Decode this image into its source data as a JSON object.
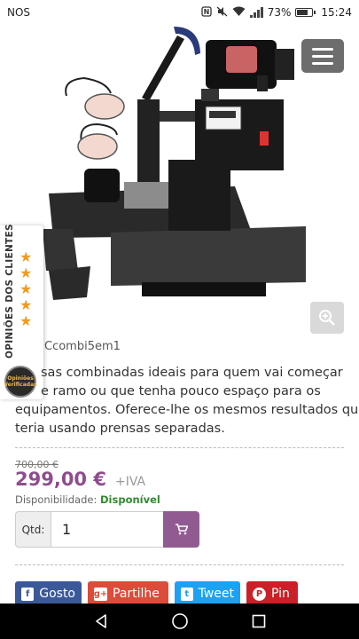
{
  "status_bar": {
    "carrier": "NOS",
    "battery_percent": "73%",
    "battery_level": 0.73,
    "time": "15:24",
    "icons": [
      "nfc-icon",
      "mute-icon",
      "wifi-icon",
      "signal-icon",
      "battery-icon"
    ]
  },
  "header": {
    "menu_icon": "hamburger-icon"
  },
  "product_image": {
    "zoom_icon": "zoom-in-icon"
  },
  "reviews": {
    "label": "OPINIÕES DOS CLIENTES",
    "star_count": 5,
    "badge_text": "Opiniões Verificadas"
  },
  "product": {
    "sku": "Ccombi5em1",
    "description_lines": [
      "sas combinadas ideais para quem vai começar",
      "e ramo ou que tenha pouco espaço para os",
      "equipamentos. Oferece-lhe os mesmos resultados que",
      "teria usando prensas separadas."
    ],
    "old_price": "700,00 €",
    "price": "299,00 €",
    "vat_label": "+IVA",
    "availability_label": "Disponibilidade:",
    "availability_value": "Disponível",
    "qty_label": "Qtd:",
    "qty_value": "1",
    "cart_icon": "cart-icon"
  },
  "social": [
    {
      "label": "Gosto",
      "icon": "facebook-icon",
      "color": "#3b5998"
    },
    {
      "label": "Partilhe",
      "icon": "google-plus-icon",
      "color": "#dd4b39"
    },
    {
      "label": "Tweet",
      "icon": "twitter-icon",
      "color": "#1da1f2"
    },
    {
      "label": "Pin",
      "icon": "pinterest-icon",
      "color": "#cb2027"
    }
  ],
  "colors": {
    "price": "#8e4d8d",
    "cart_button": "#915b91",
    "available": "#2e8b2e",
    "star": "#f39a1e",
    "menu_button": "#6d6d6d"
  },
  "navbar": {
    "icons": [
      "back-icon",
      "home-icon",
      "recents-icon"
    ]
  }
}
